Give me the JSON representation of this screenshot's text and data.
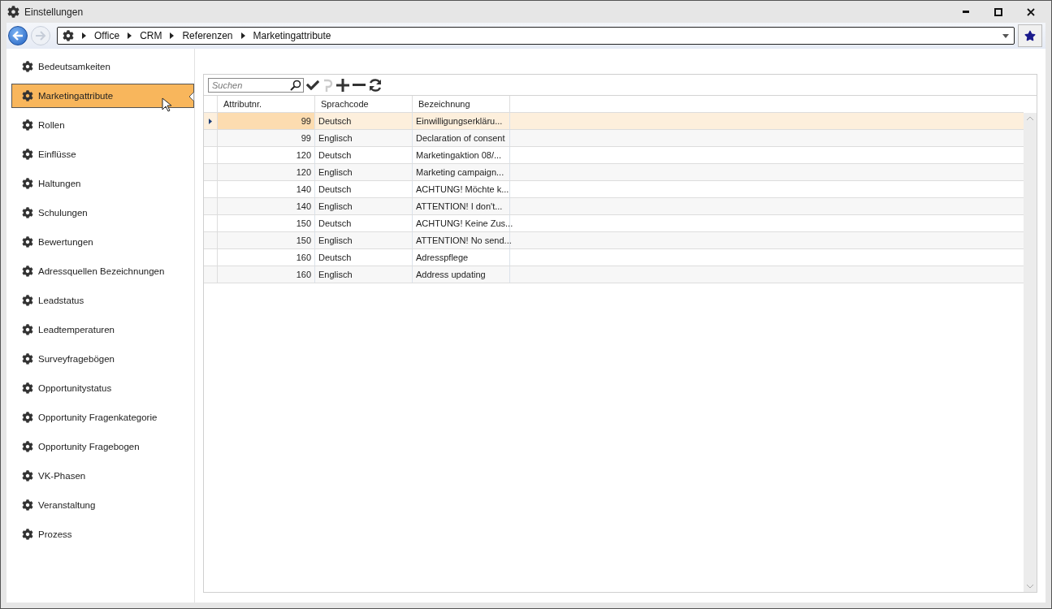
{
  "window": {
    "title": "Einstellungen"
  },
  "breadcrumb": [
    "Office",
    "CRM",
    "Referenzen",
    "Marketingattribute"
  ],
  "sidebar": {
    "items": [
      {
        "label": "Bedeutsamkeiten",
        "selected": false
      },
      {
        "label": "Marketingattribute",
        "selected": true
      },
      {
        "label": "Rollen",
        "selected": false
      },
      {
        "label": "Einflüsse",
        "selected": false
      },
      {
        "label": "Haltungen",
        "selected": false
      },
      {
        "label": "Schulungen",
        "selected": false
      },
      {
        "label": "Bewertungen",
        "selected": false
      },
      {
        "label": "Adressquellen Bezeichnungen",
        "selected": false
      },
      {
        "label": "Leadstatus",
        "selected": false
      },
      {
        "label": "Leadtemperaturen",
        "selected": false
      },
      {
        "label": "Surveyfragebögen",
        "selected": false
      },
      {
        "label": "Opportunitystatus",
        "selected": false
      },
      {
        "label": "Opportunity Fragenkategorie",
        "selected": false
      },
      {
        "label": "Opportunity Fragebogen",
        "selected": false
      },
      {
        "label": "VK-Phasen",
        "selected": false
      },
      {
        "label": "Veranstaltung",
        "selected": false
      },
      {
        "label": "Prozess",
        "selected": false
      }
    ]
  },
  "search": {
    "placeholder": "Suchen"
  },
  "table": {
    "columns": [
      "Attributnr.",
      "Sprachcode",
      "Bezeichnung"
    ],
    "rows": [
      {
        "cells": [
          "99",
          "Deutsch",
          "Einwilligungserkläru..."
        ],
        "selected": true
      },
      {
        "cells": [
          "99",
          "Englisch",
          "Declaration of consent"
        ],
        "selected": false
      },
      {
        "cells": [
          "120",
          "Deutsch",
          "Marketingaktion 08/..."
        ],
        "selected": false
      },
      {
        "cells": [
          "120",
          "Englisch",
          "Marketing campaign..."
        ],
        "selected": false
      },
      {
        "cells": [
          "140",
          "Deutsch",
          "ACHTUNG! Möchte k..."
        ],
        "selected": false
      },
      {
        "cells": [
          "140",
          "Englisch",
          "ATTENTION! I don't..."
        ],
        "selected": false
      },
      {
        "cells": [
          "150",
          "Deutsch",
          "ACHTUNG! Keine Zus..."
        ],
        "selected": false
      },
      {
        "cells": [
          "150",
          "Englisch",
          "ATTENTION! No send..."
        ],
        "selected": false
      },
      {
        "cells": [
          "160",
          "Deutsch",
          "Adresspflege"
        ],
        "selected": false
      },
      {
        "cells": [
          "160",
          "Englisch",
          "Address updating"
        ],
        "selected": false
      }
    ]
  }
}
